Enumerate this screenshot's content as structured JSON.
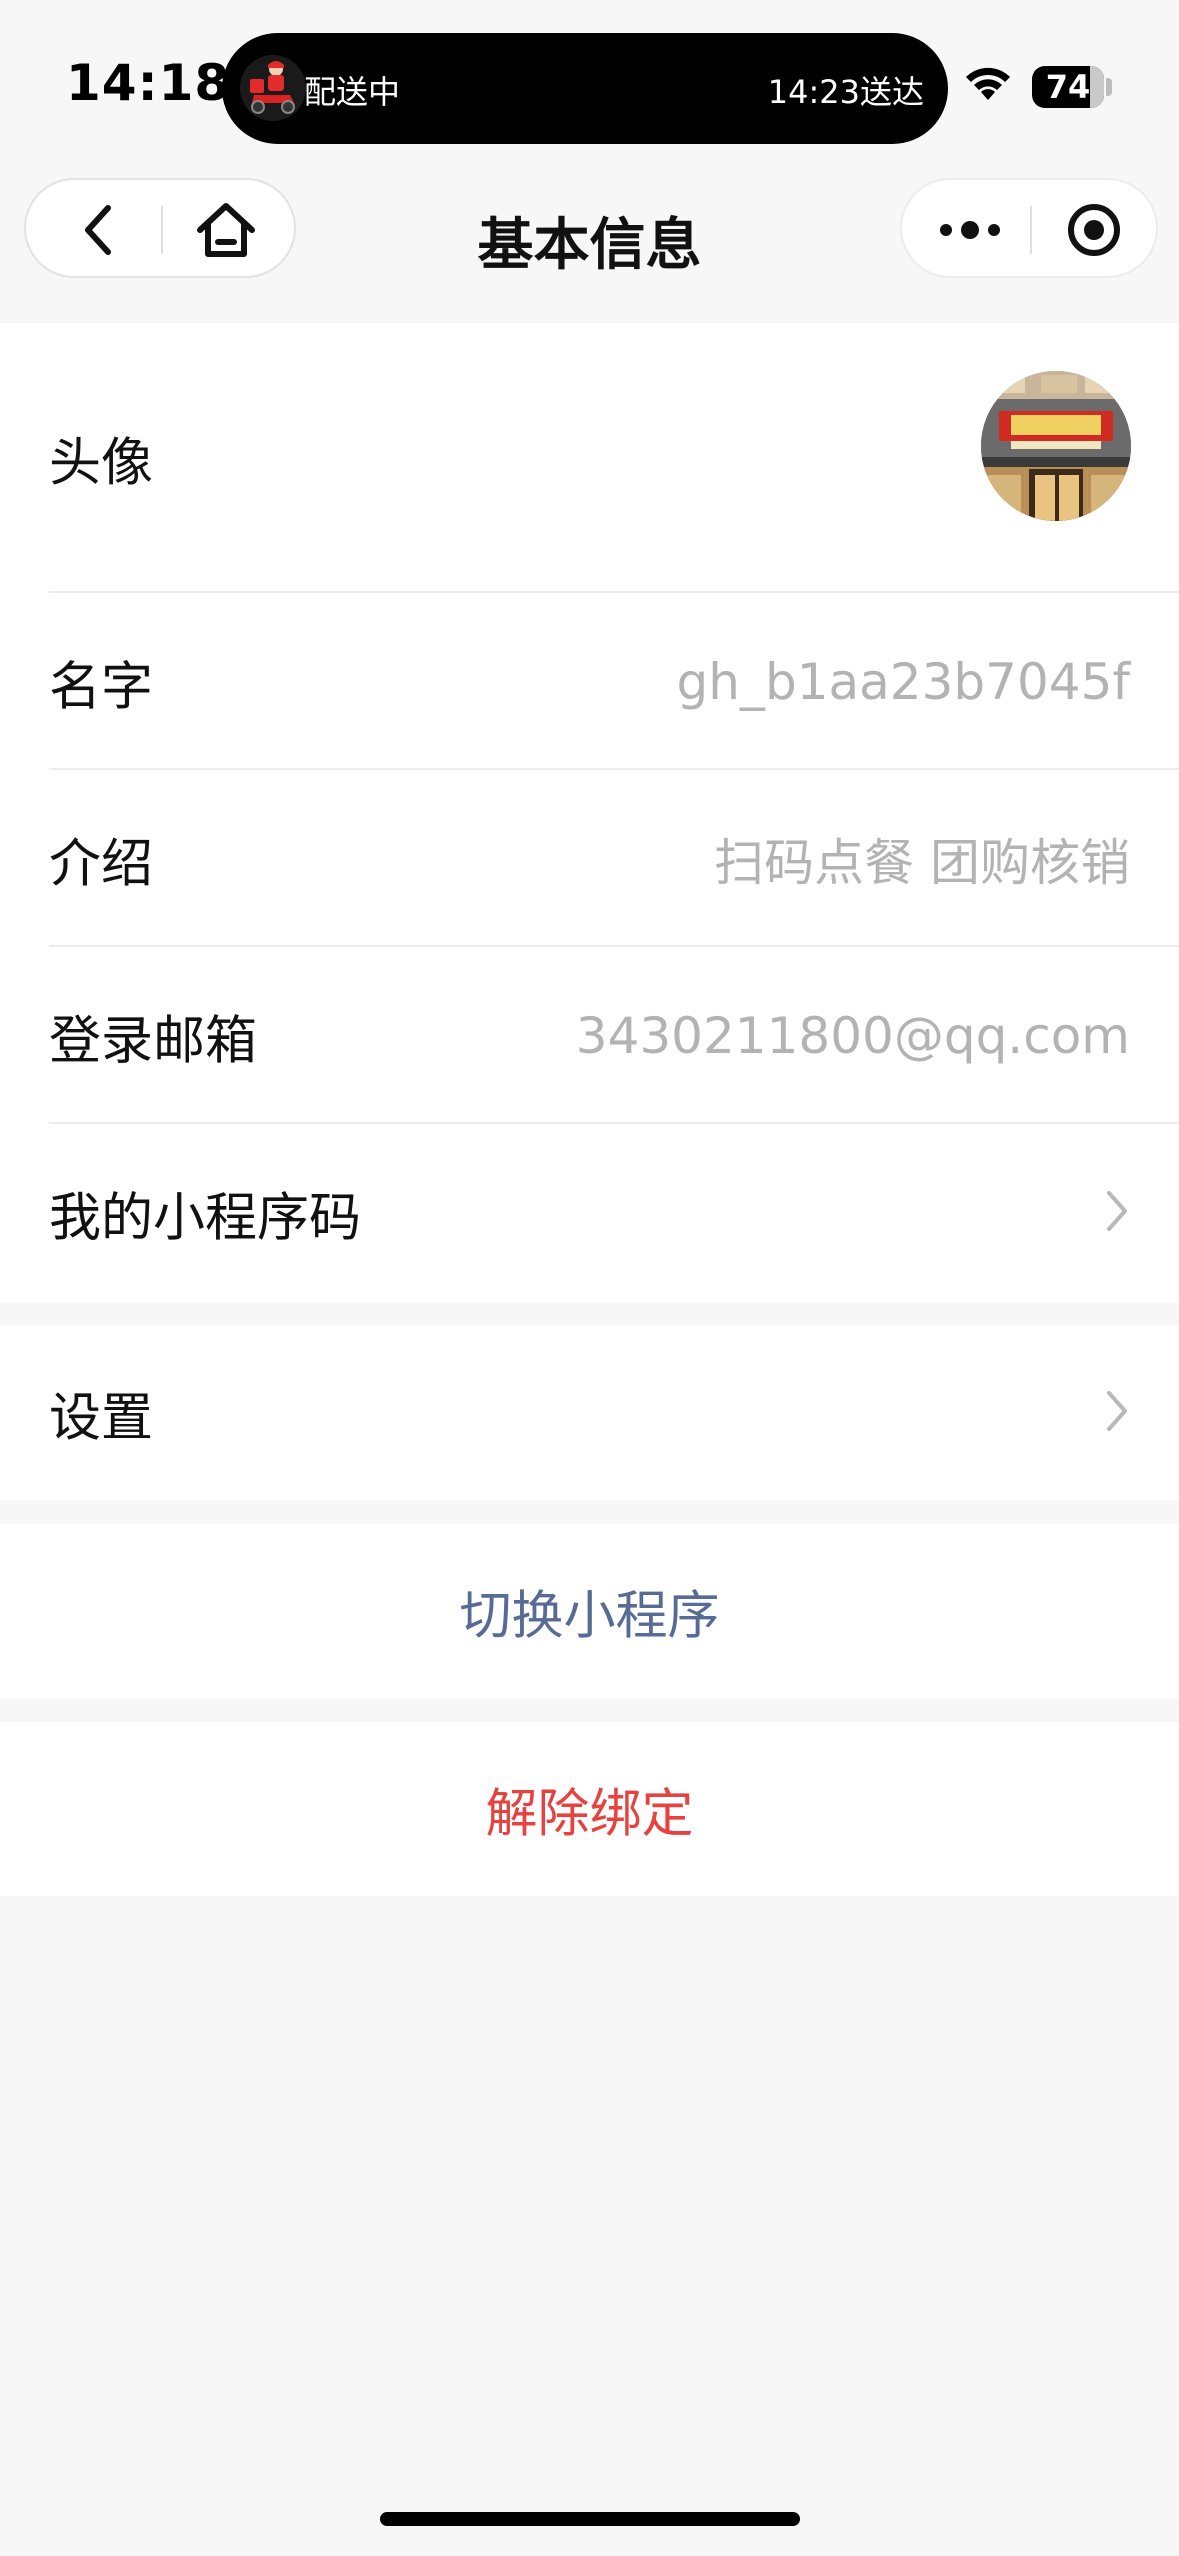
{
  "status_bar": {
    "time": "14:18",
    "live_activity": {
      "left_text": "配送中",
      "right_text": "14:23送达",
      "icon": "delivery-rider-icon"
    },
    "battery": "74",
    "wifi_icon": "wifi-icon"
  },
  "nav": {
    "title": "基本信息",
    "back_icon": "chevron-left-icon",
    "home_icon": "home-icon",
    "more_icon": "more-dots-icon",
    "close_icon": "target-close-icon"
  },
  "info": {
    "avatar_label": "头像",
    "name_label": "名字",
    "name_value": "gh_b1aa23b7045f",
    "intro_label": "介绍",
    "intro_value": "扫码点餐 团购核销",
    "email_label": "登录邮箱",
    "email_value": "3430211800@qq.com",
    "qrcode_label": "我的小程序码"
  },
  "settings": {
    "label": "设置"
  },
  "actions": {
    "switch_label": "切换小程序",
    "unbind_label": "解除绑定"
  },
  "colors": {
    "link_blue": "#576b95",
    "danger_red": "#e64340",
    "value_gray": "#b3b3b3",
    "background": "#f7f7f7"
  }
}
